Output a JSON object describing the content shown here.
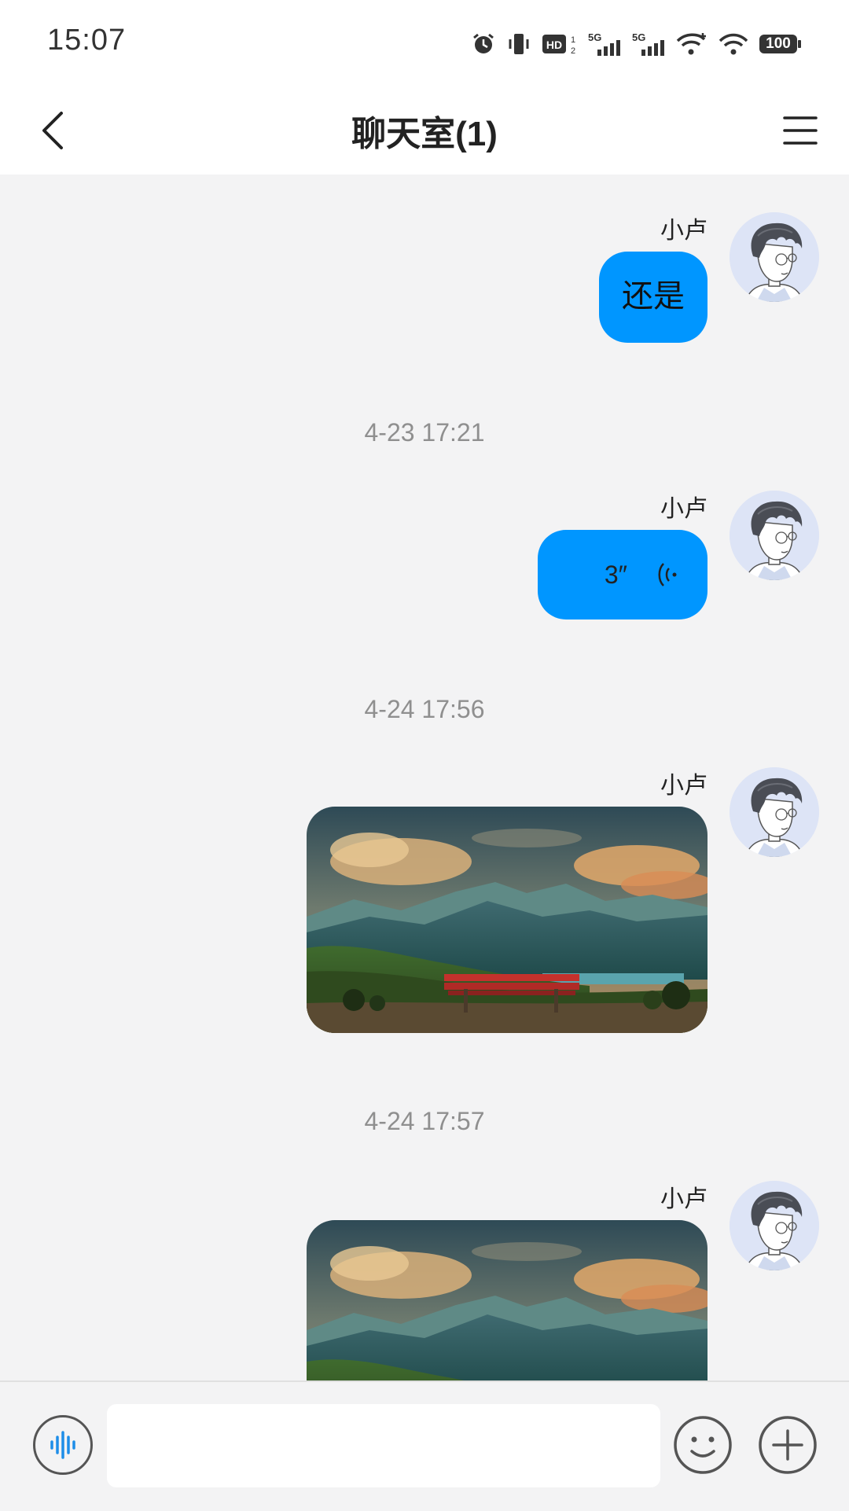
{
  "status_bar": {
    "time": "15:07",
    "battery": "100",
    "network_1": "5G",
    "network_2": "5G",
    "hd_label": "HD",
    "icons": [
      "alarm-icon",
      "vibrate-icon",
      "hd-icon",
      "signal-5g-icon",
      "signal-5g-icon",
      "wifi-plus-icon",
      "wifi-icon",
      "battery-icon"
    ]
  },
  "header": {
    "title": "聊天室(1)",
    "back_icon": "chevron-left-icon",
    "menu_icon": "hamburger-menu-icon"
  },
  "messages": [
    {
      "type": "text",
      "sender": "小卢",
      "text": "还是"
    },
    {
      "type": "timestamp",
      "text": "4-23 17:21"
    },
    {
      "type": "voice",
      "sender": "小卢",
      "duration": "3″"
    },
    {
      "type": "timestamp",
      "text": "4-24 17:56"
    },
    {
      "type": "image",
      "sender": "小卢"
    },
    {
      "type": "timestamp",
      "text": "4-24 17:57"
    },
    {
      "type": "image",
      "sender": "小卢"
    }
  ],
  "input_bar": {
    "placeholder": "",
    "voice_icon": "voice-wave-icon",
    "emoji_icon": "smiley-icon",
    "plus_icon": "plus-circle-icon"
  },
  "colors": {
    "bubble": "#0096ff",
    "background": "#f3f3f4",
    "header_bg": "#ffffff",
    "timestamp_text": "#8f8f8f"
  }
}
